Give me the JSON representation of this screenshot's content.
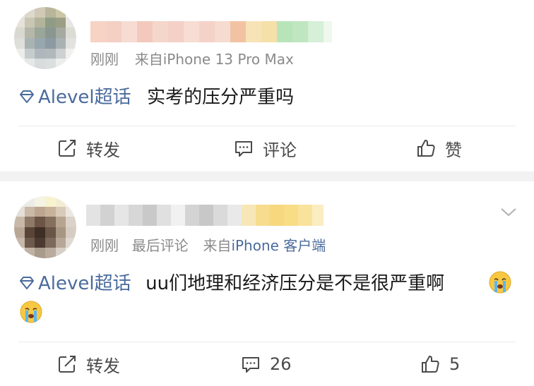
{
  "colors": {
    "accent_topic": "#4a6b9c",
    "meta_gray": "#8a8a8a",
    "text": "#1a1a1a",
    "separator": "#f2f2f2"
  },
  "post1": {
    "meta_time": "刚刚",
    "meta_source": "来自iPhone 13 Pro Max",
    "topic_name": "Alevel超话",
    "content": "实考的压分严重吗",
    "actions": {
      "repost": "转发",
      "comment": "评论",
      "like": "赞"
    }
  },
  "post2": {
    "meta_time": "刚刚",
    "meta_extra": "最后评论",
    "meta_source_prefix": "来自",
    "meta_client": "iPhone 客户端",
    "topic_name": "Alevel超话",
    "content": "uu们地理和经济压分是不是很严重啊",
    "actions": {
      "repost": "转发",
      "comment_count": "26",
      "like_count": "5"
    }
  }
}
